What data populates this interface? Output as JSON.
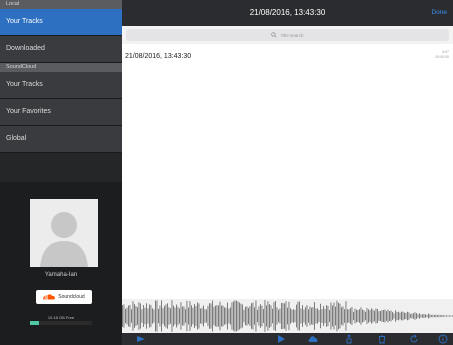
{
  "sidebar": {
    "sections": [
      {
        "header": "Local",
        "items": [
          {
            "label": "Your Tracks",
            "active": true
          },
          {
            "label": "Downloaded"
          }
        ]
      },
      {
        "header": "SoundCloud",
        "items": [
          {
            "label": "Your Tracks"
          },
          {
            "label": "Your Favorites"
          },
          {
            "label": "Global"
          }
        ]
      }
    ],
    "profile": {
      "username": "Yamaha-Ian",
      "soundcloud_button": "Soundcloud",
      "storage_text": "10.18 GB Free",
      "storage_used_fraction": 0.15
    }
  },
  "header": {
    "title": "21/08/2016, 13:43:30",
    "done_label": "Done"
  },
  "search": {
    "placeholder": "Title search"
  },
  "track": {
    "title": "21/08/2016, 13:43:30",
    "meta_line1": "0:07",
    "meta_line2": "00:00:00"
  },
  "toolbar": {
    "icons": [
      "play-icon",
      "play-icon",
      "cloud-upload-icon",
      "share-icon",
      "trash-icon",
      "refresh-icon",
      "info-icon"
    ]
  },
  "colors": {
    "accent": "#2d6fc0",
    "done": "#3a8ff5",
    "storage": "#4fc6a4",
    "soundcloud": "#ff5500"
  }
}
